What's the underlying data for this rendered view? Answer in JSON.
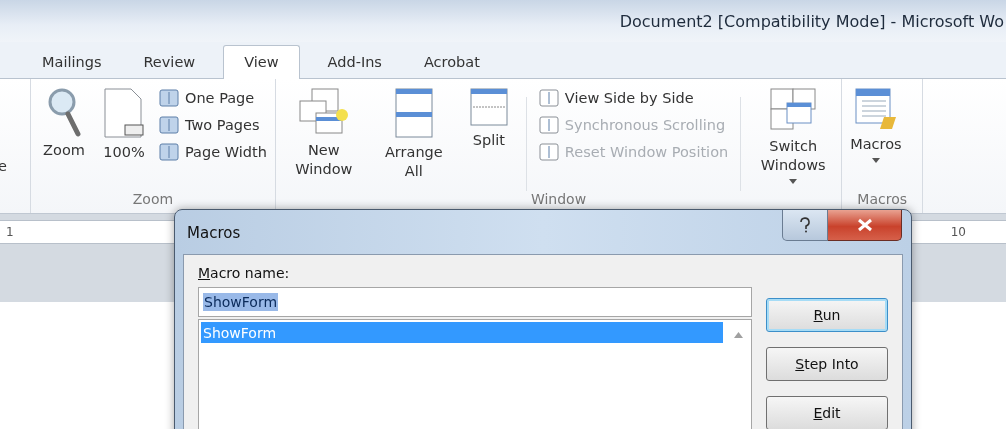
{
  "window": {
    "title": "Document2 [Compatibility Mode] - Microsoft Wo"
  },
  "tabs": [
    {
      "label": "Mailings",
      "selected": false
    },
    {
      "label": "Review",
      "selected": false
    },
    {
      "label": "View",
      "selected": true
    },
    {
      "label": "Add-Ins",
      "selected": false
    },
    {
      "label": "Acrobat",
      "selected": false
    }
  ],
  "ribbon": {
    "cut_label": "e",
    "groups": [
      {
        "label": "Zoom",
        "items": [
          {
            "kind": "large",
            "label": "Zoom",
            "dropdown": false
          },
          {
            "kind": "large",
            "label": "100%",
            "dropdown": false
          },
          {
            "kind": "stack",
            "entries": [
              {
                "label": "One Page",
                "disabled": false
              },
              {
                "label": "Two Pages",
                "disabled": false
              },
              {
                "label": "Page Width",
                "disabled": false
              }
            ]
          }
        ]
      },
      {
        "label": "Window",
        "items": [
          {
            "kind": "large",
            "label": "New Window",
            "dropdown": false
          },
          {
            "kind": "large",
            "label": "Arrange All",
            "dropdown": false
          },
          {
            "kind": "large",
            "label": "Split",
            "dropdown": false
          },
          {
            "kind": "stack",
            "entries": [
              {
                "label": "View Side by Side",
                "disabled": false
              },
              {
                "label": "Synchronous Scrolling",
                "disabled": true
              },
              {
                "label": "Reset Window Position",
                "disabled": true
              }
            ]
          },
          {
            "kind": "large",
            "label": "Switch Windows",
            "dropdown": true
          }
        ]
      },
      {
        "label": "Macros",
        "items": [
          {
            "kind": "large",
            "label": "Macros",
            "dropdown": true
          }
        ]
      }
    ]
  },
  "ruler": {
    "numbers": [
      "1",
      "10"
    ]
  },
  "dialog": {
    "title": "Macros",
    "field_label": {
      "text": "Macro name:"
    },
    "name_field": {
      "value": "ShowForm",
      "selected": true
    },
    "macros": [
      {
        "name": "ShowForm",
        "selected": true
      }
    ],
    "buttons": [
      {
        "label": "Run",
        "default": true
      },
      {
        "label": "Step Into",
        "default": false
      },
      {
        "label": "Edit",
        "default": false
      }
    ]
  }
}
